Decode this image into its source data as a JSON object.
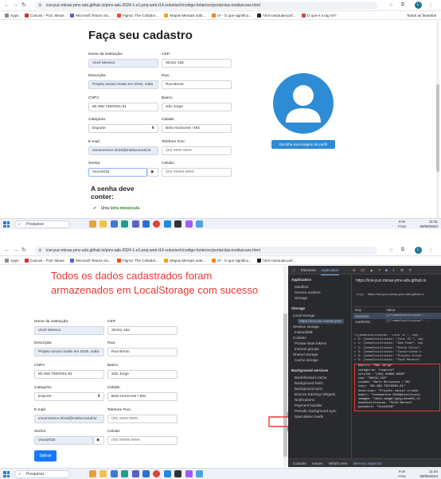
{
  "browser": {
    "url1": "icei-puc-minas-pmv-ads.github.io/pmv-ads-2024-1-e1-proj-web-t14-voluntech/codigo-fonte/src/portal-das-instituicoes.html",
    "url2": "icei-puc-minas-pmv-ads.github.io/pmv-ads-2024-1-e1-proj-web-t14-voluntech/codigo-fonte/src/portal-das-instituicoes.html",
    "profile_initial": "L",
    "bookmarks": [
      "Apps",
      "Canvas - PUC Minas",
      "Microsoft Teams cla...",
      "Figma: The Collabor...",
      "Mapas Mentais sobr...",
      "c# - O que significa...",
      "html-css/aulas-pof...",
      "O que é a tag rel?"
    ],
    "all_favorites": "Todos os favoritos"
  },
  "form": {
    "title": "Faça seu cadastro",
    "labels": {
      "institution_name": "Nome da instituição:",
      "cep": "CEP:",
      "description": "Descrição:",
      "street": "Rua:",
      "cnpj": "CNPJ:",
      "neighborhood": "Bairro:",
      "category": "Categoria:",
      "city": "Cidade:",
      "email": "E-mail:",
      "landline": "Telefone Fixo:",
      "password": "Senha:",
      "cellphone": "Celular:"
    },
    "values": {
      "institution_name": "Você Mereca",
      "cep": "30431-182",
      "description": "Projeto social criado em 2016, volta",
      "street": "Rua Bento",
      "cnpj": "80.468.736/0001-61",
      "neighborhood": "São Jorge",
      "category": "Esporte",
      "city": "Belo Horizonte / MG",
      "email": "vocemerece.2016@institucional.br",
      "landline_placeholder": "(99) 9999-9999",
      "password": "Voce2016",
      "cellphone_placeholder": "(99) 99999-9999"
    },
    "photo_button": "Escolha sua imagem de perfil",
    "password_rules_title": "A senha deve conter:",
    "password_rule_1_prefix": "Uma ",
    "password_rule_1_bold": "letra minúscula",
    "save_button": "Salvar"
  },
  "annotation": {
    "line1": "Todos os dados cadastrados foram",
    "line2": "armazenados em LocalStorage com sucesso"
  },
  "taskbar": {
    "search": "Pesquisar",
    "lang1": "POR",
    "lang2": "PTB2",
    "time1": "11:41",
    "date1": "09/06/2024",
    "time2": "11:44",
    "date2": "09/06/2024"
  },
  "devtools": {
    "tabs": [
      "Elements",
      "Application"
    ],
    "badge_errors": "22",
    "badge_warn": "7",
    "badge_info": "1",
    "sidebar": {
      "application": "Application",
      "manifest": "Manifest",
      "service_workers": "Service workers",
      "storage_item": "Storage",
      "storage_section": "Storage",
      "local_storage": "Local storage",
      "local_origin": "https://icei-puc-minas-pmv",
      "session_storage": "Session storage",
      "indexeddb": "IndexedDB",
      "cookies": "Cookies",
      "private_state": "Private state tokens",
      "interest_groups": "Interest groups",
      "shared_storage": "Shared storage",
      "cache_storage": "Cache storage",
      "bg_section": "Background services",
      "bg_fetch": "Back/forward cache",
      "bg_fetch2": "Background fetch",
      "bg_sync": "Background sync",
      "bounce": "Bounce tracking mitigatio",
      "notifications": "Notifications",
      "payment": "Payment handler",
      "periodic": "Periodic background sync",
      "speculative": "Speculative loads"
    },
    "origin_header": "https://icei-puc-minas-pmv-ads.github.io",
    "origin_label": "Origin",
    "origin_value": "https://icei-puc-minas-pmv-ads.github.io",
    "key_col": "Key",
    "value_col": "Value",
    "rows": [
      {
        "key": "usuarios",
        "value": "[{\"nomeInstituicao\":..."
      },
      {
        "key": "cardONG",
        "value": "[{\"nomeInstituicao\":..."
      }
    ],
    "preview_lines": [
      "▾[{nomeInstituicao: \"Cine 76 \", cep: \"",
      "▸ 0: {nomeInstituicao: \"Cine 76 \", cep",
      "▸ 1: {nomeInstituicao: \"Sem Fome\", cep",
      "▸ 2: {nomeInstituicao: \"Bicho Solto\",",
      "▸ 3: {nomeInstituicao: \"Construindo o",
      "▸ 4: {nomeInstituicao: \"Projeto Estud",
      "▾ 5: {nomeInstituicao: \"Você Merece\",",
      "bairro: \"São Jorge\"",
      "categoria: \"esporte\"",
      "celular: \"(99) 99999-9999\"",
      "cep: \"30431-182\"",
      "cidade: \"Belo Horizonte / MG\"",
      "cnpj: \"80.468.736/0001-61\"",
      "descricao: \"Projeto social criado",
      "email: \"vocemerece.2016@institucio",
      "imagem: \"data:image/jpeg;base64,/9",
      "nomeInstituicao: \"Você Merece\"",
      "password: \"Voce2016\""
    ],
    "bottom_tabs": [
      "Console",
      "Issues",
      "What's new",
      "Memory inspector"
    ]
  }
}
